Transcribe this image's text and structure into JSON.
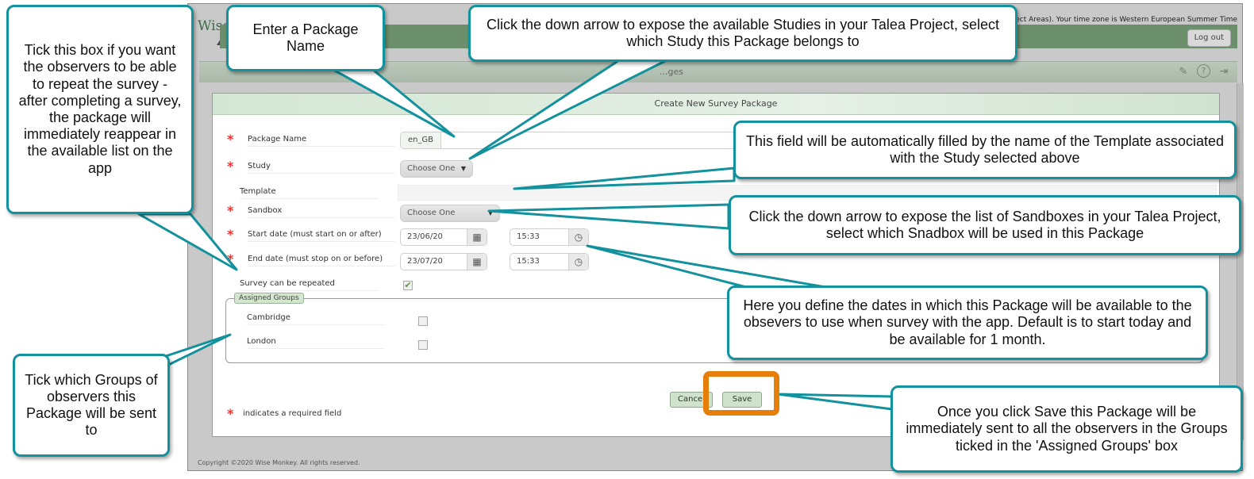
{
  "app": {
    "logo_text": "Wise",
    "timezone_text": "ject Areas). Your time zone is Western European Summer Time",
    "logout_label": "Log out",
    "subbar_title": "...ges",
    "icons": [
      "pencil-icon",
      "help-icon",
      "exit-icon"
    ]
  },
  "form": {
    "title": "Create New Survey Package",
    "fields": {
      "package_name": {
        "label": "Package Name",
        "prefix": "en_GB",
        "value": "",
        "required": true
      },
      "study": {
        "label": "Study",
        "value": "Choose One",
        "required": true
      },
      "template": {
        "label": "Template",
        "value": ""
      },
      "sandbox": {
        "label": "Sandbox",
        "value": "Choose One",
        "required": true
      },
      "start_date": {
        "label": "Start date (must start on or after)",
        "date": "23/06/20",
        "time": "15:33",
        "required": true
      },
      "end_date": {
        "label": "End date (must stop on or before)",
        "date": "23/07/20",
        "time": "15:33",
        "required": true
      },
      "repeatable": {
        "label": "Survey can be repeated",
        "checked": true
      }
    },
    "assigned_groups": {
      "legend": "Assigned Groups",
      "groups": [
        {
          "name": "Cambridge",
          "checked": false
        },
        {
          "name": "London",
          "checked": false
        }
      ]
    },
    "cancel_label": "Cancel",
    "save_label": "Save",
    "required_marker": "*",
    "required_note": "indicates a required field",
    "checkmark": "✔",
    "copyright": "Copyright ©2020 Wise Monkey. All rights reserved."
  },
  "callouts": {
    "repeat": "Tick this box if you want the observers to be able to repeat the survey - after completing a survey, the package will immediately reappear in the available list on the app",
    "package_name": "Enter a Package Name",
    "study": "Click the down arrow to expose the available Studies in your Talea Project, select which Study this Package belongs to",
    "template": "This field will be automatically filled by the name of the Template associated with the Study selected above",
    "sandbox": "Click the down arrow to expose the list of Sandboxes in your Talea Project, select which Snadbox will be used in this Package",
    "dates": "Here you define the dates in which this Package will be available to the obsevers to use when survey with the app. Default is to start today and be available for 1 month.",
    "groups": "Tick which Groups of observers this Package will be sent to",
    "save": "Once you click Save this Package will be immediately sent to all the observers in the Groups ticked in the 'Assigned Groups' box"
  },
  "colors": {
    "callout_border": "#13919c",
    "highlight": "#e67e0a",
    "header_green": "#6b8f6b",
    "required": "#e33333"
  }
}
